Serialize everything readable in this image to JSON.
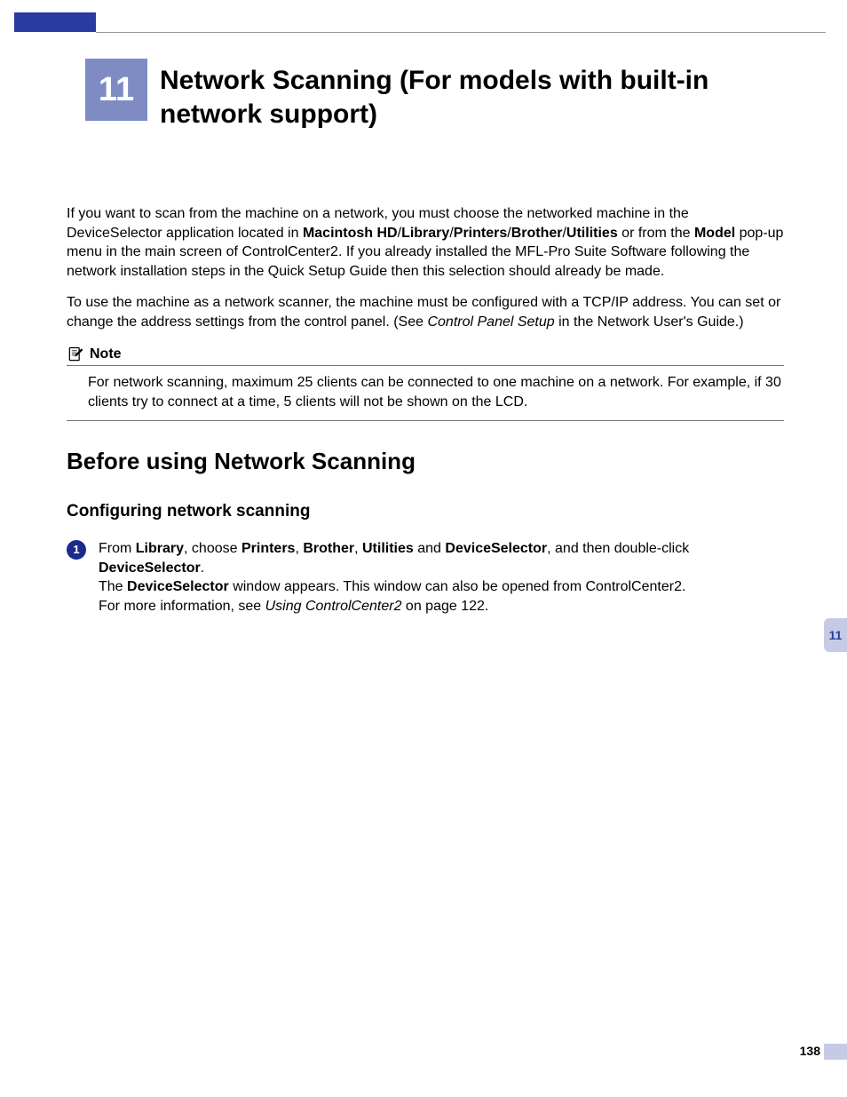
{
  "chapter": {
    "number": "11",
    "title": "Network Scanning (For models with built-in network support)"
  },
  "para1": {
    "pre": "If you want to scan from the machine on a network, you must choose the networked machine in the DeviceSelector application located in ",
    "b1": "Macintosh HD",
    "s1": "/",
    "b2": "Library",
    "s2": "/",
    "b3": "Printers",
    "s3": "/",
    "b4": "Brother",
    "s4": "/",
    "b5": "Utilities",
    "mid": " or from the ",
    "b6": "Model",
    "post": " pop-up menu in the main screen of ControlCenter2. If you already installed the MFL-Pro Suite Software following the network installation steps in the Quick Setup Guide then this selection should already be made."
  },
  "para2": {
    "pre": "To use the machine as a network scanner, the machine must be configured with a TCP/IP address. You can set or change the address settings from the control panel. (See ",
    "italic": "Control Panel Setup",
    "post": " in the Network User's Guide.)"
  },
  "note": {
    "label": "Note",
    "body": "For network scanning, maximum 25 clients can be connected to one machine on a network. For example, if 30 clients try to connect at a time, 5 clients will not be shown on the LCD."
  },
  "h2": "Before using Network Scanning",
  "h3": "Configuring network scanning",
  "step1": {
    "num": "1",
    "l1_pre": "From ",
    "l1_b1": "Library",
    "l1_s1": ", choose ",
    "l1_b2": "Printers",
    "l1_s2": ", ",
    "l1_b3": "Brother",
    "l1_s3": ", ",
    "l1_b4": "Utilities",
    "l1_s4": " and ",
    "l1_b5": "DeviceSelector",
    "l1_s5": ", and then double-click ",
    "l1_b6": "DeviceSelector",
    "l1_s6": ".",
    "l2_pre": "The ",
    "l2_b1": "DeviceSelector",
    "l2_post": " window appears. This window can also be opened from ControlCenter2.",
    "l3_pre": "For more information, see ",
    "l3_italic": "Using ControlCenter2",
    "l3_post": " on page 122."
  },
  "sideTab": "11",
  "pageNumber": "138"
}
